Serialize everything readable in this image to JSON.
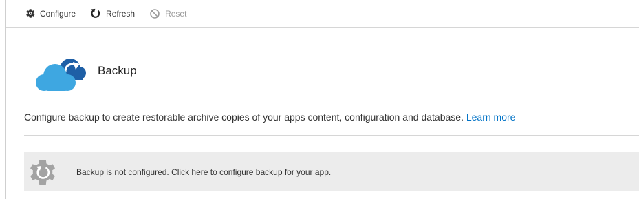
{
  "toolbar": {
    "configure_label": "Configure",
    "refresh_label": "Refresh",
    "reset_label": "Reset"
  },
  "header": {
    "title": "Backup"
  },
  "description": {
    "text": "Configure backup to create restorable archive copies of your apps content, configuration and database.",
    "link_label": "Learn more"
  },
  "banner": {
    "message": "Backup is not configured. Click here to configure backup for your app."
  },
  "icons": {
    "configure": "gear-icon",
    "refresh": "refresh-icon",
    "reset": "prohibited-icon",
    "header": "cloud-backup-icon",
    "banner": "gear-refresh-icon"
  },
  "colors": {
    "accent": "#0072c6",
    "cloud": "#3ea7e1",
    "banner_bg": "#ececec",
    "banner_icon": "#a0a0a0"
  }
}
